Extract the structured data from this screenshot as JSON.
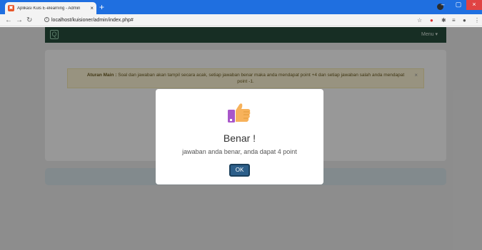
{
  "browser": {
    "tab_title": "Aplikasi Kuis E-elearning - Admin",
    "tab_close": "×",
    "new_tab": "+",
    "url": "localhost/kuisioner/admin/index.php#",
    "window": {
      "minimize": "–",
      "maximize": "▢",
      "close": "×"
    }
  },
  "app": {
    "brand_glyph": "Q",
    "menu_label": "Menu ▾"
  },
  "alert": {
    "label": "Aturan Main :",
    "text": "Soal dan jawaban akan tampil secara acak, setiap jawaban benar maka anda mendapat point +4 dan setiap jawaban salah anda mendapat point -1.",
    "close": "×"
  },
  "modal": {
    "icon": "thumbs-up-icon",
    "title": "Benar !",
    "message": "jawaban anda benar, anda dapat 4 point",
    "ok_label": "OK"
  }
}
